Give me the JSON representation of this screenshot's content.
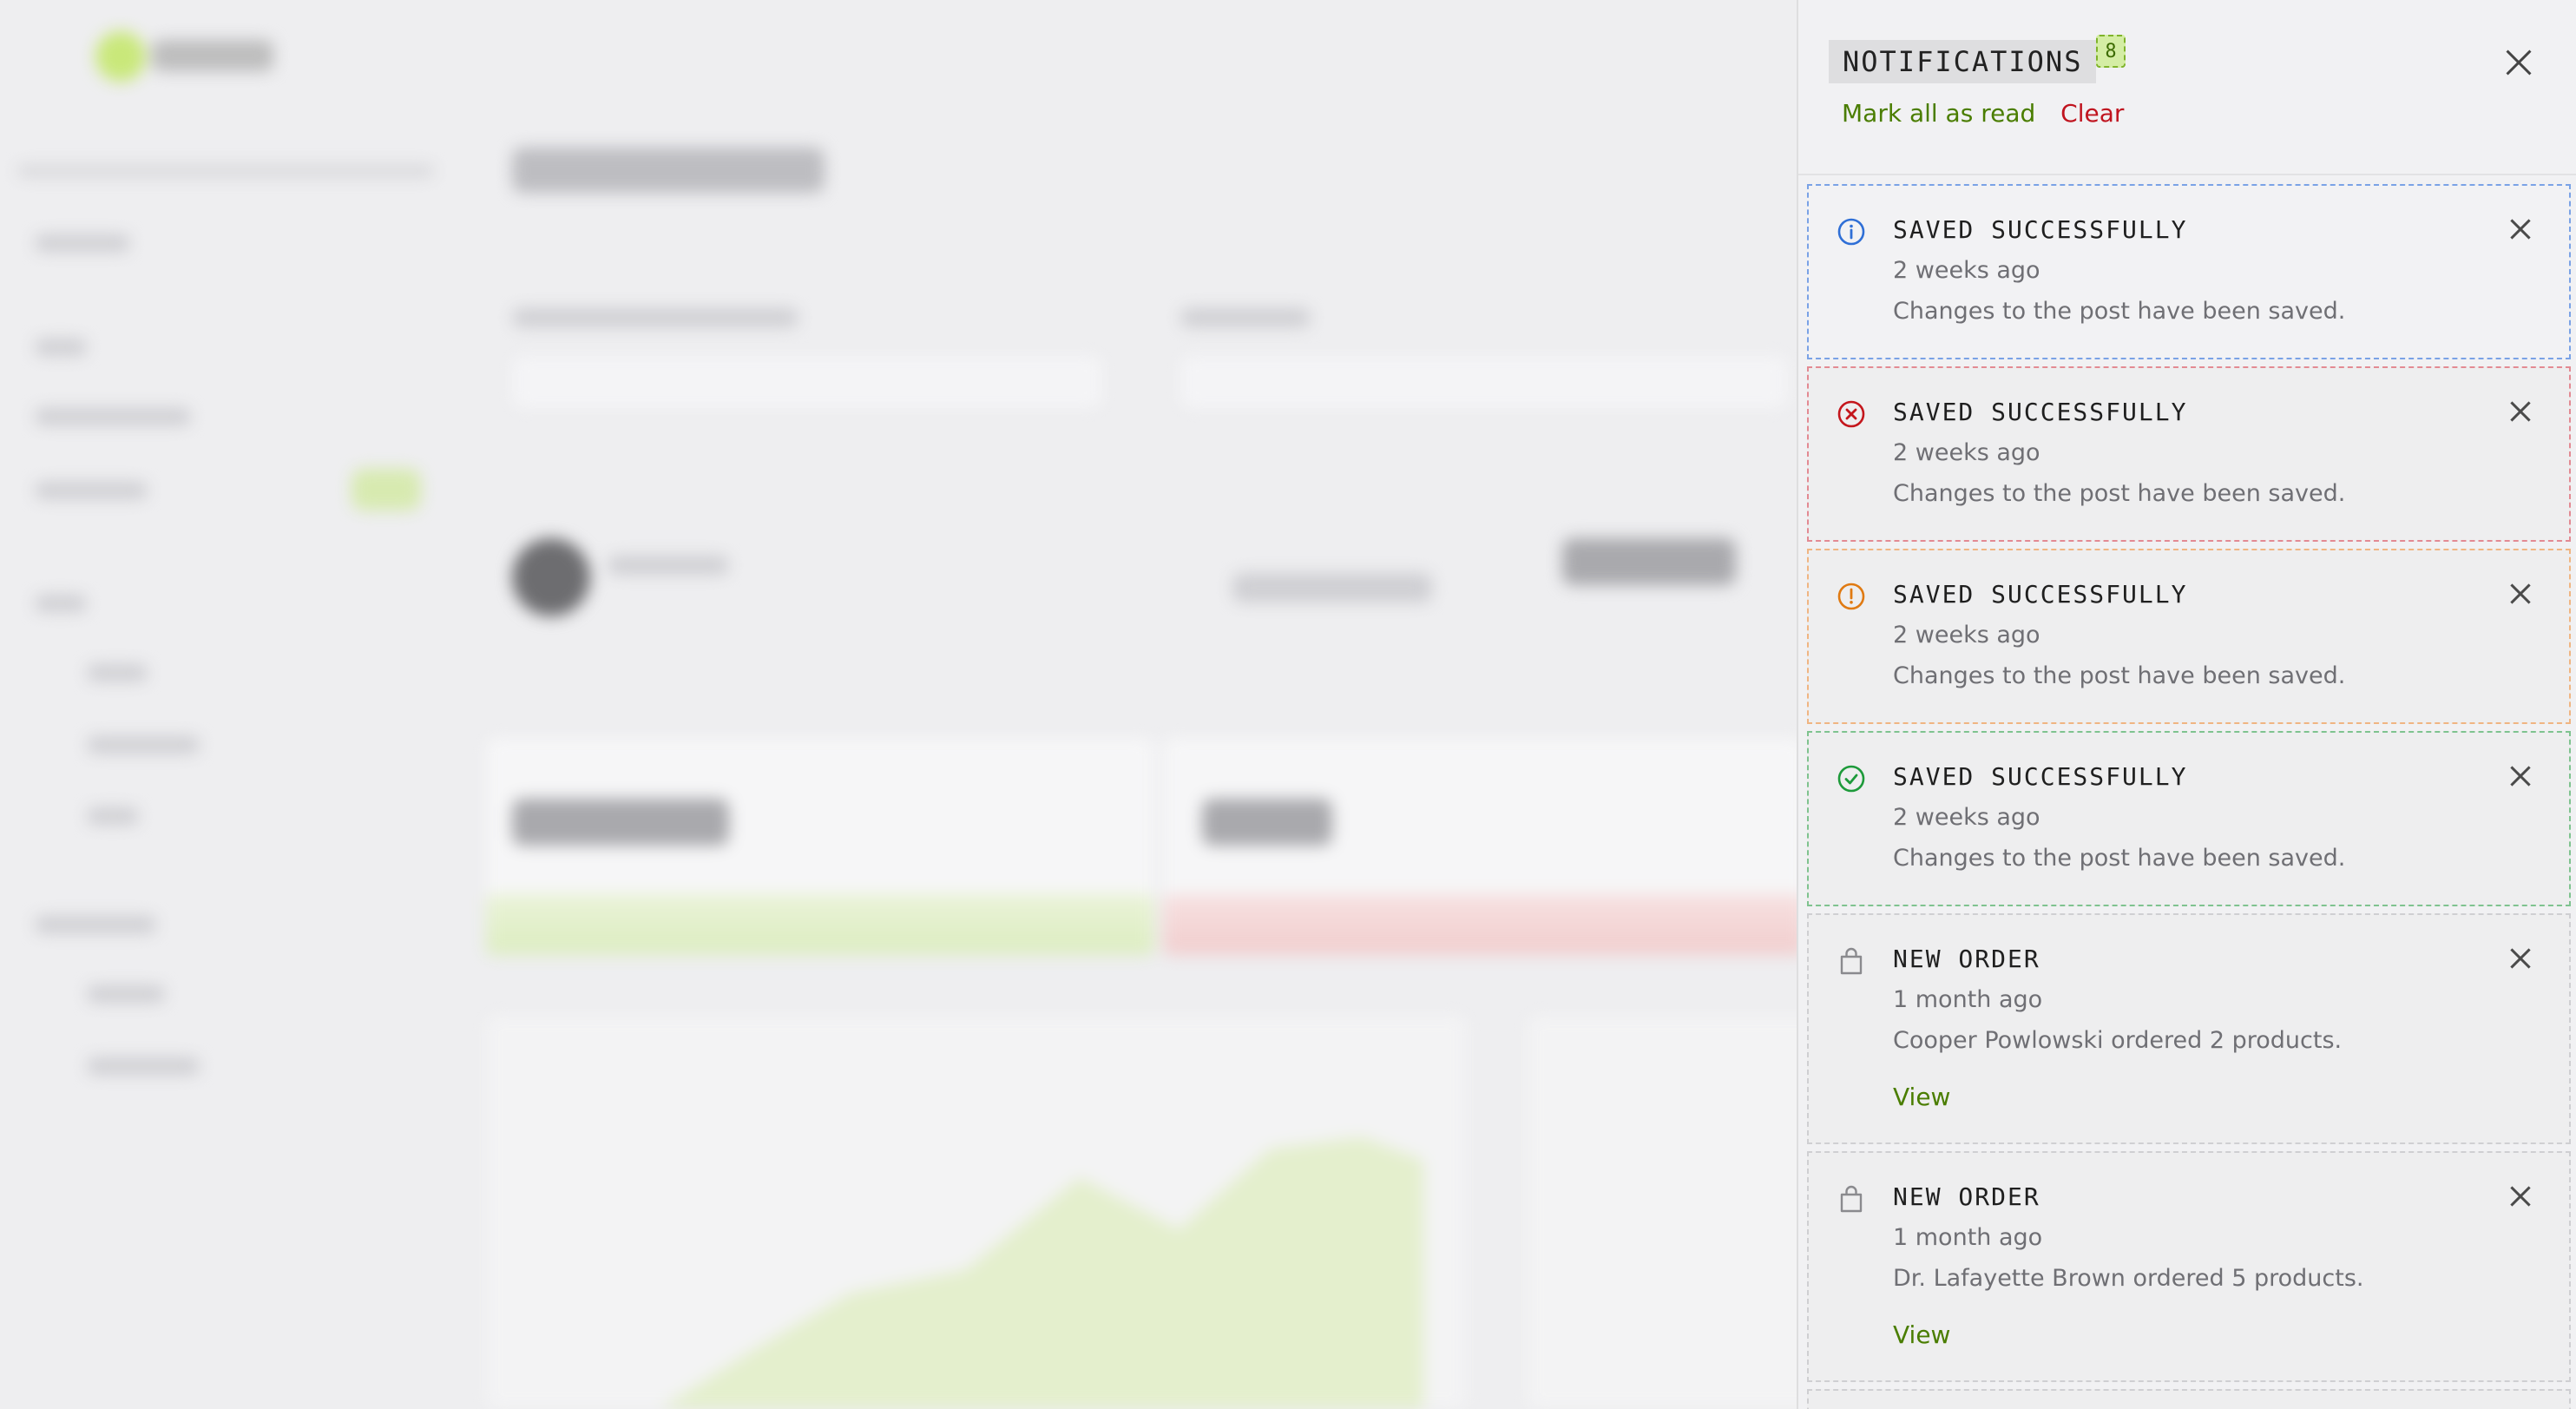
{
  "drawer": {
    "title": "NOTIFICATIONS",
    "count": "8",
    "mark_all_read_label": "Mark all as read",
    "clear_label": "Clear"
  },
  "notifications": [
    {
      "kind": "info",
      "icon": "info-circle-icon",
      "color": "#2f6fd6",
      "title": "SAVED SUCCESSFULLY",
      "time": "2 weeks ago",
      "message": "Changes to the post have been saved."
    },
    {
      "kind": "error",
      "icon": "x-circle-icon",
      "color": "#c4161c",
      "title": "SAVED SUCCESSFULLY",
      "time": "2 weeks ago",
      "message": "Changes to the post have been saved."
    },
    {
      "kind": "warning",
      "icon": "exclamation-circle-icon",
      "color": "#e07a12",
      "title": "SAVED SUCCESSFULLY",
      "time": "2 weeks ago",
      "message": "Changes to the post have been saved."
    },
    {
      "kind": "success",
      "icon": "check-circle-icon",
      "color": "#1d9a3a",
      "title": "SAVED SUCCESSFULLY",
      "time": "2 weeks ago",
      "message": "Changes to the post have been saved."
    },
    {
      "kind": "order",
      "icon": "shopping-bag-icon",
      "color": "#8a8a8e",
      "title": "NEW ORDER",
      "time": "1 month ago",
      "message": "Cooper Powlowski ordered 2 products.",
      "action_label": "View"
    },
    {
      "kind": "order",
      "icon": "shopping-bag-icon",
      "color": "#8a8a8e",
      "title": "NEW ORDER",
      "time": "1 month ago",
      "message": "Dr. Lafayette Brown ordered 5 products.",
      "action_label": "View"
    }
  ],
  "colors": {
    "accent": "#4a7d00",
    "danger": "#c0141f"
  }
}
